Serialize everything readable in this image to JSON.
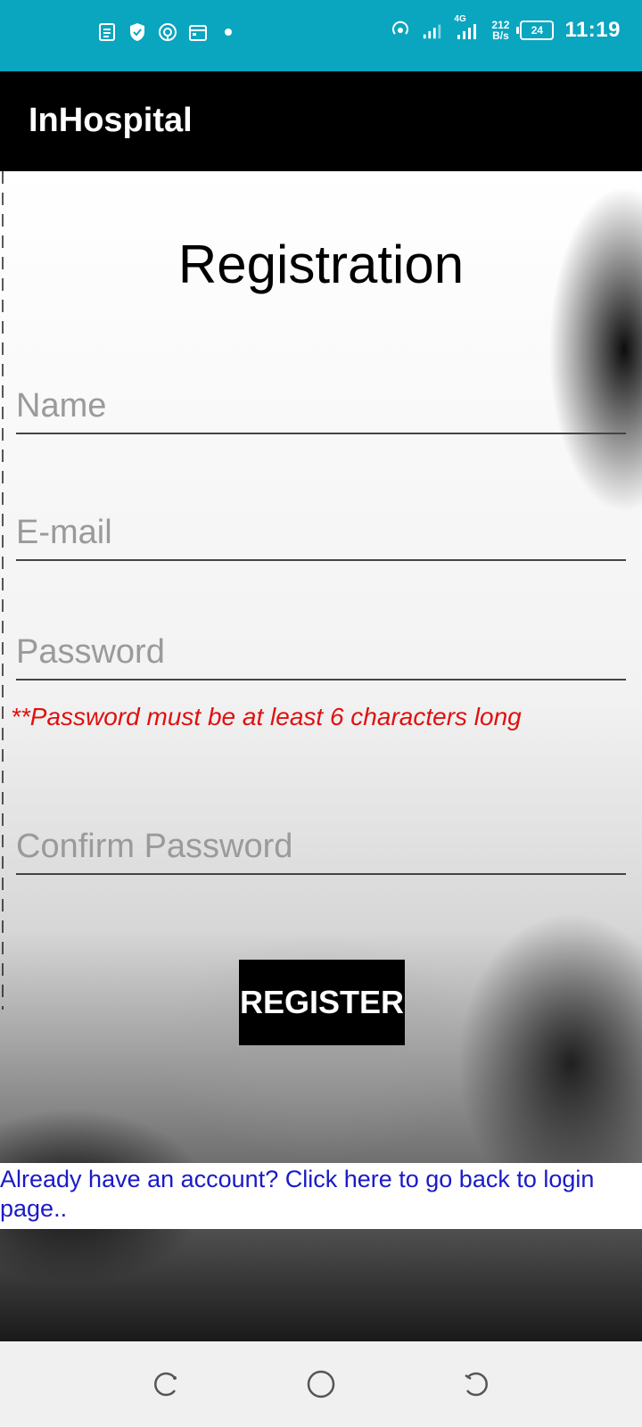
{
  "status_bar": {
    "time": "11:19",
    "network": "4G",
    "net_speed_value": "212",
    "net_speed_unit": "B/s",
    "battery": "24",
    "bg_color": "#0aa5bf"
  },
  "app_bar": {
    "title": "InHospital"
  },
  "form": {
    "heading": "Registration",
    "name_placeholder": "Name",
    "email_placeholder": "E-mail",
    "password_placeholder": "Password",
    "password_hint": "**Password must be at least 6 characters long",
    "confirm_password_placeholder": "Confirm Password",
    "register_label": "REGISTER",
    "login_link": "Already have an account? Click here to go back to login page.."
  },
  "colors": {
    "accent": "#0aa5bf",
    "hint_red": "#e01010",
    "link_blue": "#1a1ac8"
  },
  "nav_bar": {
    "icons": [
      "recent-apps-icon",
      "home-icon",
      "back-icon"
    ]
  }
}
